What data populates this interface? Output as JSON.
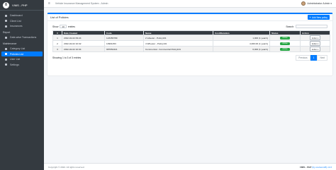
{
  "brand": {
    "logo": "8",
    "name": "VIMS - PHP"
  },
  "sidebar": {
    "items": [
      {
        "label": "Dashboard",
        "icon": "dashboard-icon"
      },
      {
        "label": "Client List",
        "icon": "users-icon"
      },
      {
        "label": "Insurances",
        "icon": "shield-icon"
      }
    ],
    "report_header": "Report",
    "report_items": [
      {
        "label": "Date-wise Transactions",
        "icon": "calendar-icon"
      }
    ],
    "maintenance_header": "Maintenance",
    "maintenance_items": [
      {
        "label": "Category List",
        "icon": "list-icon"
      },
      {
        "label": "Policies List",
        "icon": "file-icon",
        "active": true
      },
      {
        "label": "User List",
        "icon": "user-icon"
      },
      {
        "label": "Settings",
        "icon": "gear-icon"
      }
    ]
  },
  "topbar": {
    "menu_glyph": "≡",
    "title": "Vehicle Insurance Management System - Admin",
    "user_name": "Administrator Admin",
    "caret": "▾"
  },
  "card": {
    "title": "List of Policies",
    "add_button": "Add New policy",
    "add_glyph": "+"
  },
  "controls": {
    "show_label": "Show",
    "entries_value": "10",
    "entries_label": "entries",
    "search_label": "Search:"
  },
  "table": {
    "headers": [
      "#",
      "Date Created",
      "Code",
      "Name",
      "Cost/Duration",
      "Status",
      "Action"
    ],
    "rows": [
      {
        "n": "1",
        "date": "2022-02-02 09:24",
        "code": "123456789",
        "name": "2 wheeler - Policy101",
        "cost": "1,000 (1 year/s)",
        "status": "Active",
        "action": "Action"
      },
      {
        "n": "2",
        "date": "2022-02-02 10:02",
        "code": "10901453",
        "name": "4 Wheeler - Policy101",
        "cost": "4,000.00 (1 year/s)",
        "status": "Active",
        "action": "Action"
      },
      {
        "n": "3",
        "date": "2022-02-02 10:04",
        "code": "987654321",
        "name": "Commercial - Commercial Policy101",
        "cost": "6,000 (1 year/s)",
        "status": "Active",
        "action": "Action"
      }
    ]
  },
  "pagination": {
    "info": "Showing 1 to 3 of 3 entries",
    "previous": "Previous",
    "current": "1",
    "next": "Next"
  },
  "footer": {
    "copyright": "Copyright © 2022. All rights reserved.",
    "app_name": "VIMS - PHP",
    "version_label": "(by oretnom23) v1.0"
  },
  "colors": {
    "primary": "#007bff",
    "sidebar": "#343a40",
    "success": "#28a745"
  }
}
